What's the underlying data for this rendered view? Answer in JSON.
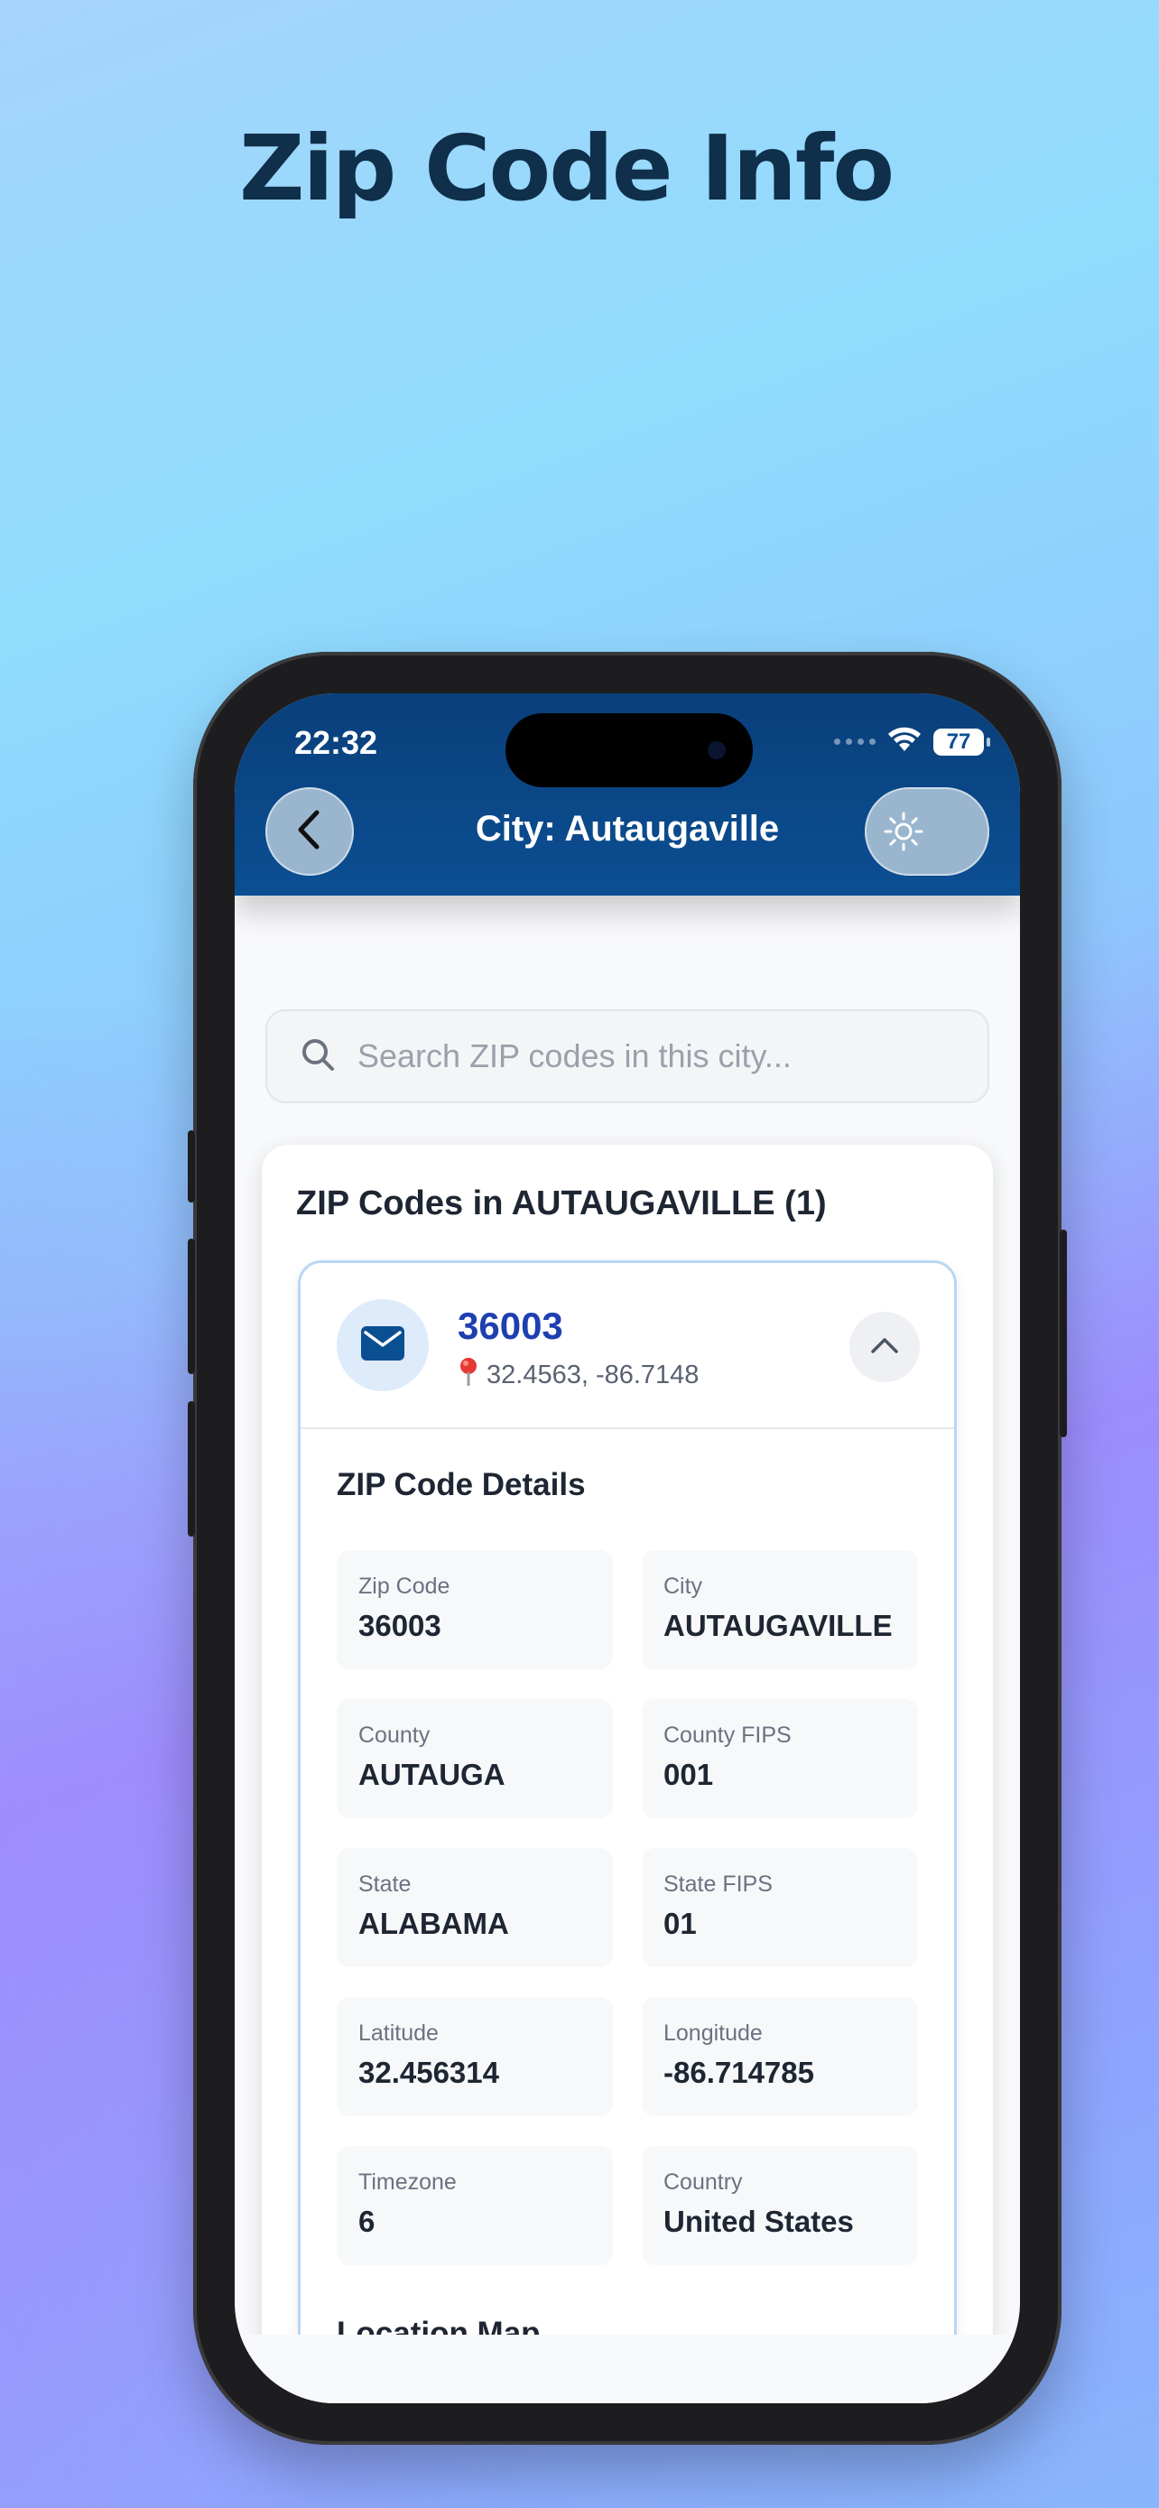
{
  "headline": "Zip Code Info",
  "status_bar": {
    "time": "22:32",
    "battery": "77"
  },
  "nav": {
    "title": "City: Autaugaville"
  },
  "search": {
    "placeholder": "Search ZIP codes in this city..."
  },
  "list": {
    "title": "ZIP Codes in AUTAUGAVILLE (1)",
    "items": [
      {
        "zip": "36003",
        "coords": "32.4563, -86.7148",
        "details_title": "ZIP Code Details",
        "details": [
          {
            "label": "Zip Code",
            "value": "36003"
          },
          {
            "label": "City",
            "value": "AUTAUGAVILLE"
          },
          {
            "label": "County",
            "value": "AUTAUGA"
          },
          {
            "label": "County FIPS",
            "value": "001"
          },
          {
            "label": "State",
            "value": "ALABAMA"
          },
          {
            "label": "State FIPS",
            "value": "01"
          },
          {
            "label": "Latitude",
            "value": "32.456314"
          },
          {
            "label": "Longitude",
            "value": "-86.714785"
          },
          {
            "label": "Timezone",
            "value": "6"
          },
          {
            "label": "Country",
            "value": "United States"
          }
        ],
        "map_title": "Location Map"
      }
    ]
  },
  "icons": {
    "back": "chevron-left-icon",
    "theme": "sun-icon",
    "search": "search-icon",
    "mail": "envelope-icon",
    "pin": "pin-icon",
    "collapse": "chevron-up-icon",
    "wifi": "wifi-icon",
    "battery": "battery-icon"
  },
  "colors": {
    "header": "#0b4f93",
    "zip_code": "#1e3fb0",
    "headline": "#0f2f4a",
    "item_border": "#b9d7f5"
  }
}
